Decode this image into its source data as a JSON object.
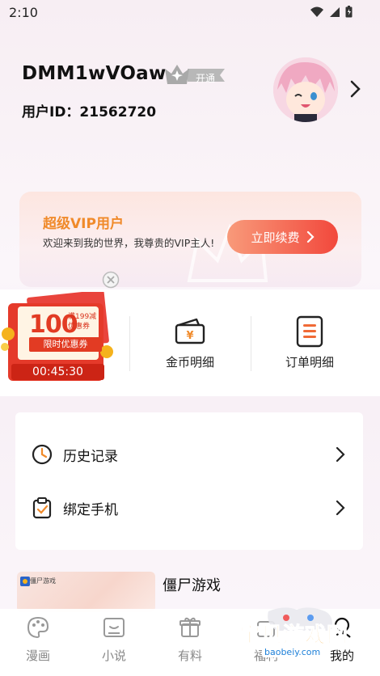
{
  "status_bar": {
    "time": "2:10",
    "icons": [
      "wifi-icon",
      "signal-icon",
      "battery-icon"
    ]
  },
  "profile": {
    "username": "DMM1wVOaw",
    "vip_badge_label": "开通",
    "user_id_label": "用户ID：21562720"
  },
  "vip_card": {
    "title": "超级VIP用户",
    "description": "欢迎来到我的世界，我尊贵的VIP主人!",
    "renew_button": "立即续费"
  },
  "coupon": {
    "amount": "100",
    "condition": "满199减优惠券",
    "ribbon": "限时优惠券",
    "timer": "00:45:30"
  },
  "quick_links": [
    {
      "label": "金币明细",
      "icon": "wallet-icon"
    },
    {
      "label": "订单明细",
      "icon": "order-list-icon"
    }
  ],
  "menu": [
    {
      "label": "历史记录",
      "icon": "clock-icon"
    },
    {
      "label": "绑定手机",
      "icon": "clipboard-check-icon"
    }
  ],
  "feature": {
    "title": "僵尸游戏",
    "thumb_text": "僵尸游戏"
  },
  "bottom_nav": [
    {
      "label": "漫画",
      "icon": "palette-icon",
      "active": false
    },
    {
      "label": "小说",
      "icon": "book-icon",
      "active": false
    },
    {
      "label": "有料",
      "icon": "gift-icon",
      "active": false
    },
    {
      "label": "福利",
      "icon": "welfare-icon",
      "active": false
    },
    {
      "label": "我的",
      "icon": "profile-icon",
      "active": true
    }
  ],
  "watermark": {
    "text": "宝贝游戏网",
    "url": "baobeiy.com"
  },
  "colors": {
    "accent_orange": "#f08a2a",
    "accent_red": "#f2483c",
    "coupon_red": "#e23b23"
  }
}
